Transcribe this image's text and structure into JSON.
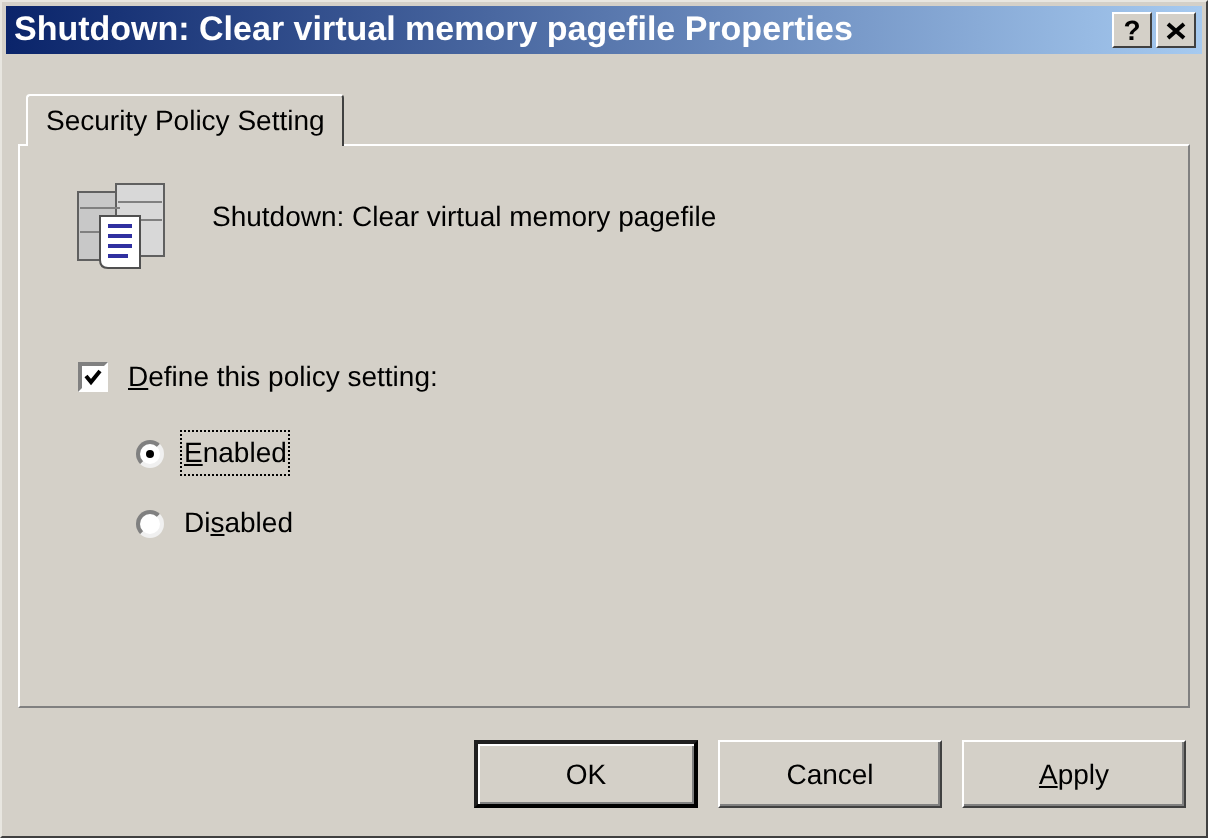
{
  "window": {
    "title": "Shutdown: Clear virtual memory pagefile Properties"
  },
  "title_buttons": [
    {
      "kind": "help",
      "label": "?"
    },
    {
      "kind": "close"
    }
  ],
  "tabs": [
    {
      "label": "Security Policy Setting",
      "selected": true
    }
  ],
  "policy": {
    "name": "Shutdown: Clear virtual memory pagefile"
  },
  "define": {
    "label": {
      "key": "D",
      "after": "efine this policy setting:"
    },
    "checked": true
  },
  "options": [
    {
      "label": {
        "key": "E",
        "after": "nabled"
      },
      "selected": true,
      "focused": true
    },
    {
      "label": {
        "before": "Di",
        "key": "s",
        "after": "abled"
      },
      "selected": false,
      "focused": false
    }
  ],
  "buttons": [
    {
      "label": {
        "before": "OK"
      },
      "default": true
    },
    {
      "label": {
        "before": "Cancel"
      },
      "default": false
    },
    {
      "label": {
        "key": "A",
        "after": "pply"
      },
      "default": false
    }
  ]
}
